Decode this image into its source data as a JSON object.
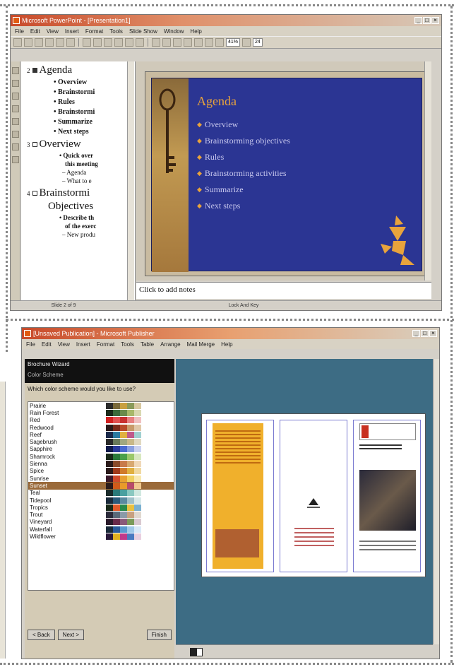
{
  "powerpoint": {
    "title": "Microsoft PowerPoint - [Presentation1]",
    "menu": [
      "File",
      "Edit",
      "View",
      "Insert",
      "Format",
      "Tools",
      "Slide Show",
      "Window",
      "Help"
    ],
    "zoom": "41%",
    "font_size": "24",
    "outline": [
      {
        "number": "2",
        "title": "Agenda",
        "bullets": [
          "Overview",
          "Brainstormi",
          "Rules",
          "Brainstormi",
          "Summarize",
          "Next steps"
        ]
      },
      {
        "number": "3",
        "title": "Overview",
        "bullets": [
          "Quick over",
          "this meeting"
        ],
        "subbullets": [
          "Agenda",
          "What to e"
        ]
      },
      {
        "number": "4",
        "title": "Brainstormi",
        "title2": "Objectives",
        "bullets": [
          "Describe th",
          "of the exerc"
        ],
        "subbullets": [
          "New produ"
        ]
      }
    ],
    "slide": {
      "title": "Agenda",
      "bullets": [
        "Overview",
        "Brainstorming objectives",
        "Rules",
        "Brainstorming activities",
        "Summarize",
        "Next steps"
      ]
    },
    "notes": "Click to add notes",
    "status": {
      "slide": "Slide 2 of 9",
      "design": "Lock And Key"
    }
  },
  "publisher": {
    "title": "[Unsaved Publication] - Microsoft Publisher",
    "menu": [
      "File",
      "Edit",
      "View",
      "Insert",
      "Format",
      "Tools",
      "Table",
      "Arrange",
      "Mail Merge",
      "Help"
    ],
    "wizard": {
      "title": "Brochure Wizard",
      "subtitle": "Color Scheme",
      "question": "Which color scheme would you like to use?",
      "selected": "Sunset",
      "buttons": {
        "back": "< Back",
        "next": "Next >",
        "finish": "Finish"
      }
    },
    "schemes": [
      {
        "name": "Prairie",
        "colors": [
          "#2a2a2a",
          "#7a6a3a",
          "#c8a040",
          "#8a9a5a",
          "#d8c8a0"
        ]
      },
      {
        "name": "Rain Forest",
        "colors": [
          "#1a2a1a",
          "#3a6a3a",
          "#6a8a4a",
          "#a8b86a",
          "#d8d8b0"
        ]
      },
      {
        "name": "Red",
        "colors": [
          "#d02020",
          "#e05050",
          "#c83030",
          "#e88080",
          "#f0c0c0"
        ]
      },
      {
        "name": "Redwood",
        "colors": [
          "#2a1a1a",
          "#7a2a1a",
          "#b84a2a",
          "#c89a6a",
          "#e0c8a8"
        ]
      },
      {
        "name": "Reef",
        "colors": [
          "#1a2a4a",
          "#2a7aa0",
          "#e0b040",
          "#c05a8a",
          "#a0d0d0"
        ]
      },
      {
        "name": "Sagebrush",
        "colors": [
          "#2a2a2a",
          "#6a7a5a",
          "#a0a880",
          "#c8b888",
          "#e0d8c0"
        ]
      },
      {
        "name": "Sapphire",
        "colors": [
          "#101a4a",
          "#2a3a9a",
          "#4a6ad0",
          "#8aa0e0",
          "#c8d0f0"
        ]
      },
      {
        "name": "Shamrock",
        "colors": [
          "#1a2a1a",
          "#2a7a3a",
          "#4aa04a",
          "#9ac86a",
          "#d8e8c0"
        ]
      },
      {
        "name": "Sienna",
        "colors": [
          "#2a1a1a",
          "#8a4a2a",
          "#c87a4a",
          "#d8a870",
          "#f0d8b8"
        ]
      },
      {
        "name": "Spice",
        "colors": [
          "#2a1a1a",
          "#a03a1a",
          "#d07a2a",
          "#e0b040",
          "#f0d8a0"
        ]
      },
      {
        "name": "Sunrise",
        "colors": [
          "#3a1a2a",
          "#d04a2a",
          "#e8a030",
          "#f0d060",
          "#f8e8b0"
        ]
      },
      {
        "name": "Sunset",
        "colors": [
          "#2a1a1a",
          "#d05a1a",
          "#e89a2a",
          "#b84a6a",
          "#f0c890"
        ]
      },
      {
        "name": "Teal",
        "colors": [
          "#1a2a2a",
          "#2a7a7a",
          "#4aa0a0",
          "#8ac8c0",
          "#d0e8e0"
        ]
      },
      {
        "name": "Tidepool",
        "colors": [
          "#1a2a3a",
          "#2a5a7a",
          "#5a8aa0",
          "#a0c0c8",
          "#d8e8e8"
        ]
      },
      {
        "name": "Tropics",
        "colors": [
          "#1a2a1a",
          "#e05a2a",
          "#2a8a4a",
          "#e8c040",
          "#7ab0d0"
        ]
      },
      {
        "name": "Trout",
        "colors": [
          "#2a2a3a",
          "#5a6a7a",
          "#8a9aa8",
          "#c8a080",
          "#e0d8d0"
        ]
      },
      {
        "name": "Vineyard",
        "colors": [
          "#2a1a2a",
          "#6a2a4a",
          "#8a5a7a",
          "#7a9a5a",
          "#d8c8d0"
        ]
      },
      {
        "name": "Waterfall",
        "colors": [
          "#1a2a3a",
          "#2a5a9a",
          "#5a9ad0",
          "#a0c8e8",
          "#d8e8f8"
        ]
      },
      {
        "name": "Wildflower",
        "colors": [
          "#2a1a3a",
          "#e0b020",
          "#c03a8a",
          "#4a7ac0",
          "#e8d0e0"
        ]
      }
    ]
  }
}
